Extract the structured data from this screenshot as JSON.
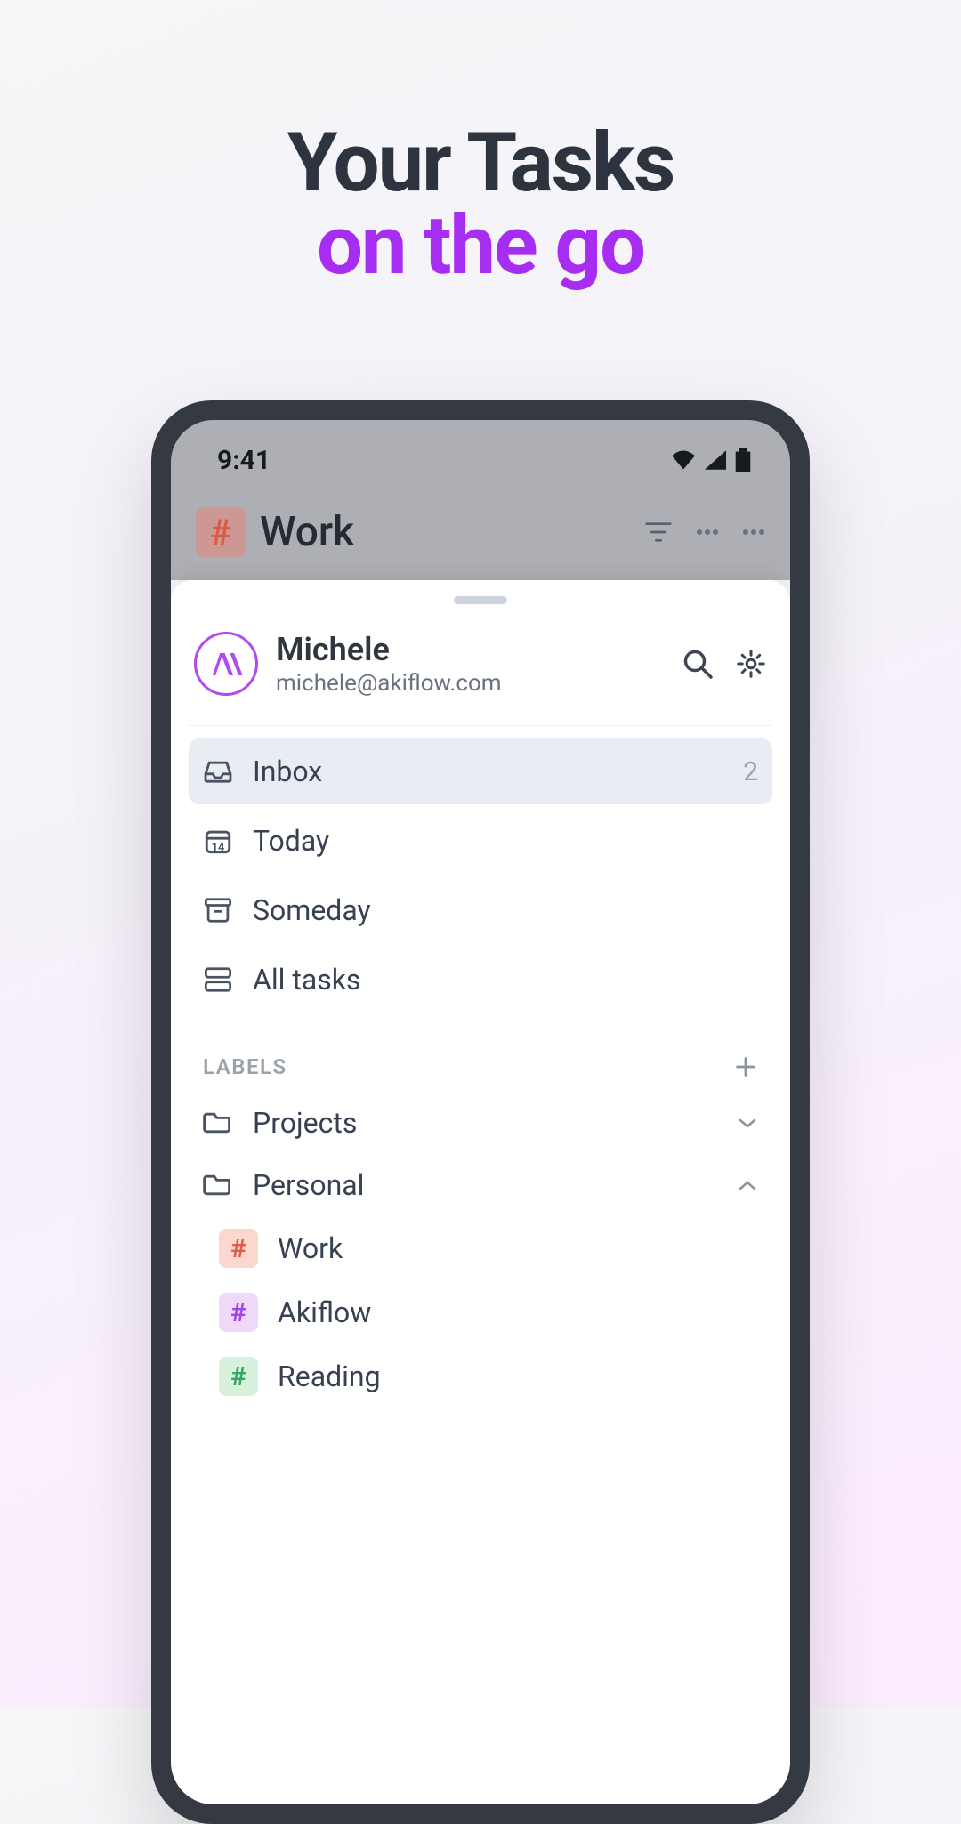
{
  "headline": {
    "line1": "Your Tasks",
    "line2": "on the go"
  },
  "statusbar": {
    "time": "9:41"
  },
  "header": {
    "context_label": "Work"
  },
  "profile": {
    "name": "Michele",
    "email": "michele@akiflow.com",
    "avatar_glyph": "/\\\\"
  },
  "nav": [
    {
      "id": "inbox",
      "label": "Inbox",
      "count": "2",
      "icon": "inbox",
      "active": true
    },
    {
      "id": "today",
      "label": "Today",
      "count": "",
      "icon": "calendar",
      "active": false,
      "day": "14"
    },
    {
      "id": "someday",
      "label": "Someday",
      "count": "",
      "icon": "archive",
      "active": false
    },
    {
      "id": "alltasks",
      "label": "All tasks",
      "count": "",
      "icon": "list",
      "active": false
    }
  ],
  "labels_section": {
    "title": "LABELS"
  },
  "folders": [
    {
      "id": "projects",
      "label": "Projects",
      "expanded": false
    },
    {
      "id": "personal",
      "label": "Personal",
      "expanded": true
    }
  ],
  "tags": [
    {
      "id": "work",
      "label": "Work",
      "color": "red"
    },
    {
      "id": "akiflow",
      "label": "Akiflow",
      "color": "purp"
    },
    {
      "id": "reading",
      "label": "Reading",
      "color": "green"
    }
  ]
}
